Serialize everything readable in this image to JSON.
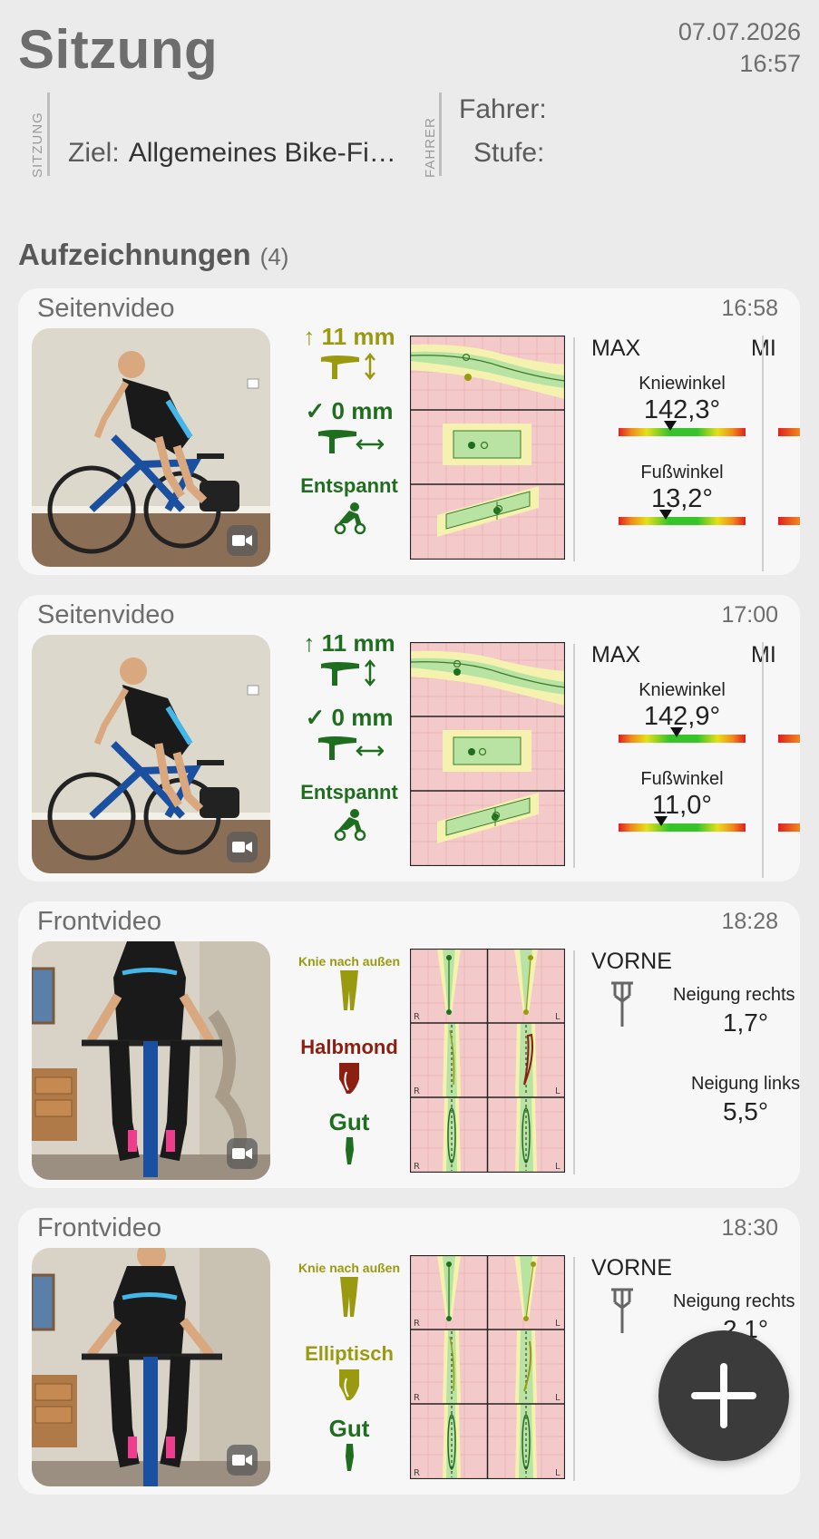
{
  "header": {
    "title": "Sitzung",
    "date": "07.07.2026",
    "time": "16:57",
    "session_label": "SITZUNG",
    "goal_label": "Ziel:",
    "goal_value": "Allgemeines Bike-Fi…",
    "rider_section_label": "FAHRER",
    "rider_label": "Fahrer:",
    "rider_value": "",
    "level_label": "Stufe:",
    "level_value": ""
  },
  "recordings": {
    "title": "Aufzeichnungen",
    "count": "(4)",
    "items": [
      {
        "type": "Seitenvideo",
        "time": "16:58",
        "metric1": "↑ 11 mm",
        "metric2": "✓ 0 mm",
        "metric3": "Entspannt",
        "stats_header": "MAX",
        "stats_header2": "MI",
        "stat1_label": "Kniewinkel",
        "stat1_value": "142,3°",
        "stat1_level": 0.37,
        "stat2_label": "Fußwinkel",
        "stat2_value": "13,2°",
        "stat2_level": 0.37
      },
      {
        "type": "Seitenvideo",
        "time": "17:00",
        "metric1": "↑ 11 mm",
        "metric2": "✓ 0 mm",
        "metric3": "Entspannt",
        "stats_header": "MAX",
        "stats_header2": "MI",
        "stat1_label": "Kniewinkel",
        "stat1_value": "142,9°",
        "stat1_level": 0.42,
        "stat2_label": "Fußwinkel",
        "stat2_value": "11,0°",
        "stat2_level": 0.33
      },
      {
        "type": "Frontvideo",
        "time": "18:28",
        "metric1": "Knie nach außen",
        "metric2": "Halbmond",
        "metric3": "Gut",
        "stats_header": "VORNE",
        "stat1_label": "Neigung rechts",
        "stat1_value": "1,7°",
        "stat2_label": "Neigung links",
        "stat2_value": "5,5°"
      },
      {
        "type": "Frontvideo",
        "time": "18:30",
        "metric1": "Knie nach außen",
        "metric2": "Elliptisch",
        "metric3": "Gut",
        "stats_header": "VORNE",
        "stat1_label": "Neigung rechts",
        "stat1_value": "2,1°"
      }
    ]
  },
  "diagram_side_label_r": "R",
  "diagram_side_label_l": "L",
  "colors": {
    "good_green": "#1f6e1f",
    "warn_olive": "#9a9a10",
    "bad_red": "#8a1f12",
    "zone_pink": "#f4c9c9",
    "zone_yellow": "#f5f2b0",
    "zone_green": "#b9e3a3"
  },
  "icons": {
    "saddle_height": "saddle-height-icon",
    "saddle_setback": "saddle-setback-icon",
    "posture": "rider-posture-icon",
    "video": "video-camera-icon",
    "leg": "leg-icon",
    "fork": "fork-icon",
    "add": "plus-icon"
  }
}
